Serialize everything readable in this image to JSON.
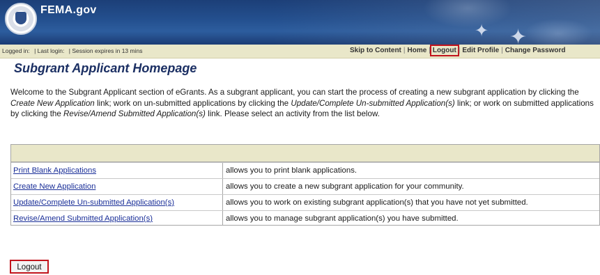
{
  "header": {
    "site_name": "FEMA.gov",
    "brand_color": "#24508f"
  },
  "session_bar": {
    "logged_in": "Logged in:",
    "last_login": "| Last login:",
    "expires": "| Session expires in 13 mins"
  },
  "topnav": {
    "items": [
      {
        "label": "Skip to Content",
        "highlighted": false
      },
      {
        "label": "Home",
        "highlighted": false
      },
      {
        "label": "Logout",
        "highlighted": true
      },
      {
        "label": "Edit Profile",
        "highlighted": false
      },
      {
        "label": "Change Password",
        "highlighted": false
      }
    ],
    "highlight_color": "#c2141c"
  },
  "page": {
    "title": "Subgrant Applicant Homepage",
    "intro": {
      "p1": "Welcome to the Subgrant Applicant section of eGrants. As a subgrant applicant, you can start the process of creating a new subgrant application by clicking the ",
      "e1": "Create New Application",
      "p2": " link; work on un-submitted applications by clicking the ",
      "e2": "Update/Complete Un-submitted Application(s)",
      "p3": " link; or work on submitted applications by clicking the ",
      "e3": "Revise/Amend Submitted Application(s)",
      "p4": " link. Please select an activity from the list below."
    }
  },
  "activities": {
    "rows": [
      {
        "link": "Print Blank Applications",
        "desc": "allows you to print blank applications."
      },
      {
        "link": "Create New Application",
        "desc": "allows you to create a new subgrant application for your community."
      },
      {
        "link": "Update/Complete Un-submitted Application(s)",
        "desc": "allows you to work on existing subgrant application(s) that you have not yet submitted."
      },
      {
        "link": "Revise/Amend Submitted Application(s)",
        "desc": "allows you to manage subgrant application(s) you have submitted."
      }
    ]
  },
  "footer": {
    "logout_label": "Logout"
  }
}
